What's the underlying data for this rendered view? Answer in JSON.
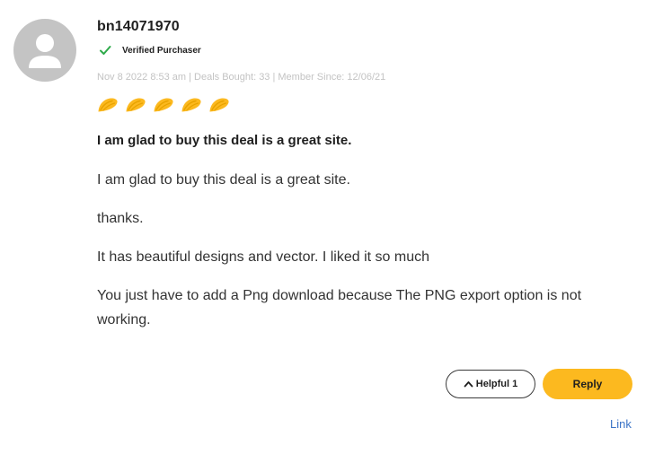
{
  "review": {
    "username": "bn14071970",
    "verified_label": "Verified Purchaser",
    "meta": "Nov 8 2022 8:53 am | Deals Bought: 33 | Member Since: 12/06/21",
    "rating": 5,
    "title": "I am glad to buy this deal is a great site.",
    "paragraphs": [
      "I am glad to buy this deal is a great site.",
      "thanks.",
      "It has beautiful designs and vector. I liked it so much",
      "You just have to add a Png download because The PNG export option is not working."
    ]
  },
  "actions": {
    "helpful_label": "Helpful",
    "helpful_count": "1",
    "reply_label": "Reply",
    "link_label": "Link"
  },
  "icons": {
    "avatar": "user-avatar-icon",
    "verified": "checkmark-icon",
    "rating": "taco-icon",
    "helpful": "chevron-up-icon"
  },
  "colors": {
    "accent": "#fcb91f",
    "verified_check": "#2eaa4a",
    "link": "#3a73c7",
    "meta_text": "#c3c3c3"
  }
}
